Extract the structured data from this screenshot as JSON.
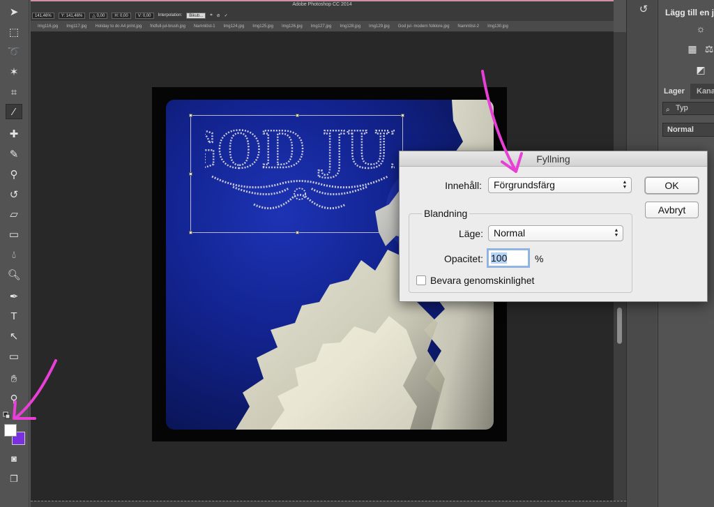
{
  "app": {
    "title": "Adobe Photoshop CC 2014"
  },
  "options_bar": {
    "items": [
      "141,46%",
      "Y: 141,46%",
      "△ 0,00",
      "H: 0,00",
      "V: 0,00",
      "Interpolation:",
      "Bikub..."
    ]
  },
  "doc_tabs": [
    "Img116.jpg",
    "Img117.jpg",
    "Holiday to do A4 print.jpg",
    "fridfull-jul-brush.jpg",
    "Namnlöst-1",
    "Img124.jpg",
    "Img125.jpg",
    "Img126.jpg",
    "Img127.jpg",
    "Img128.jpg",
    "Img129.jpg",
    "God jul- modern folklore.jpg",
    "Namnlöst-2",
    "Img130.jpg"
  ],
  "colors": {
    "foreground": "#ffffff",
    "background": "#7a2fe0",
    "annotation": "#e83fd6"
  },
  "tools": [
    "move-tool-icon",
    "marquee-tool-icon",
    "lasso-tool-icon",
    "magic-wand-icon",
    "crop-tool-icon",
    "eyedropper-icon",
    "healing-brush-icon",
    "brush-icon",
    "clone-stamp-icon",
    "history-brush-icon",
    "eraser-icon",
    "gradient-icon",
    "blur-icon",
    "dodge-icon",
    "pen-tool-icon",
    "type-tool-icon",
    "path-selection-icon",
    "rectangle-tool-icon",
    "hand-tool-icon",
    "zoom-tool-icon"
  ],
  "canvas": {
    "artwork_text": "GOD JUL"
  },
  "right_panel": {
    "adjustments_title": "Lägg till en j",
    "tabs": {
      "layers": "Lager",
      "channels": "Kana"
    },
    "filter": "Typ",
    "blend_mode": "Normal"
  },
  "dialog": {
    "title": "Fyllning",
    "content_label": "Innehåll:",
    "content_value": "Förgrundsfärg",
    "ok_label": "OK",
    "cancel_label": "Avbryt",
    "group_title": "Blandning",
    "mode_label": "Läge:",
    "mode_value": "Normal",
    "opacity_label": "Opacitet:",
    "opacity_value": "100",
    "opacity_unit": "%",
    "preserve_label": "Bevara genomskinlighet",
    "preserve_checked": false
  }
}
